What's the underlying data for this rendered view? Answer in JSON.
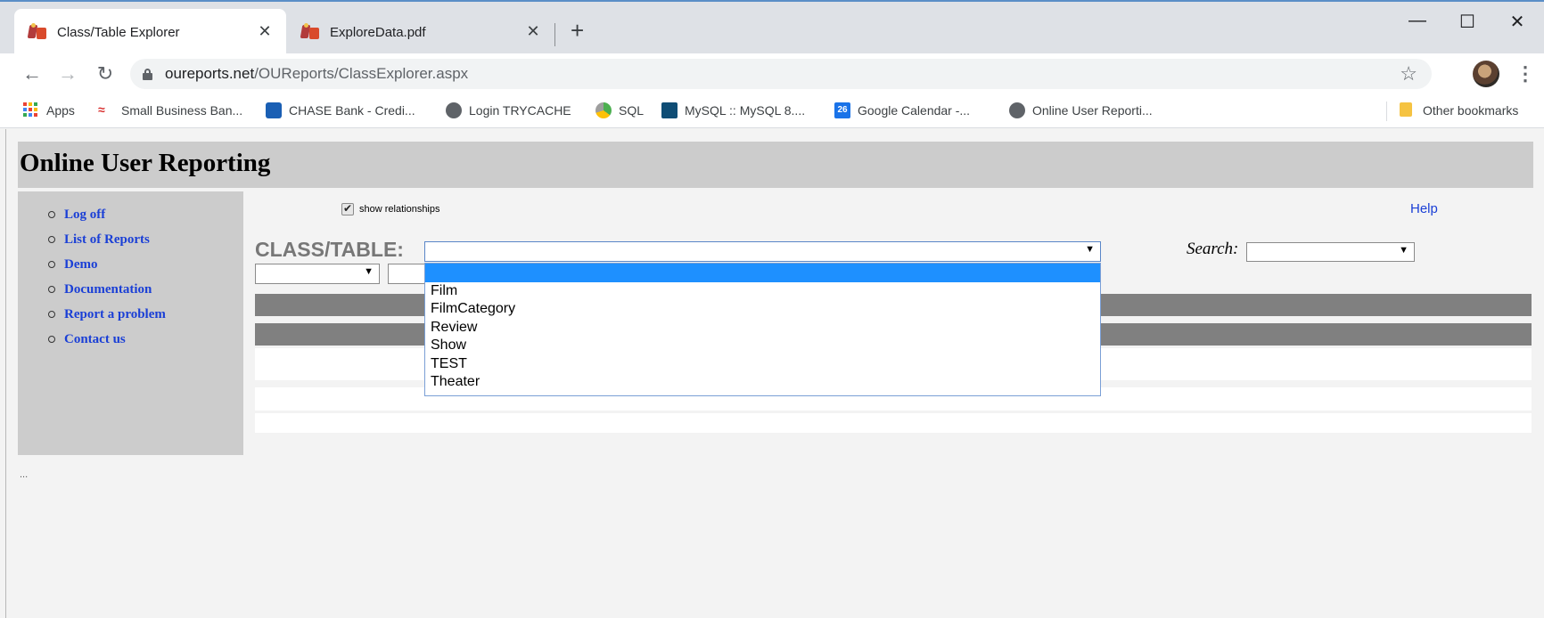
{
  "browser": {
    "tabs": [
      {
        "title": "Class/Table Explorer",
        "active": true
      },
      {
        "title": "ExploreData.pdf",
        "active": false
      }
    ],
    "url_host": "oureports.net",
    "url_path": "/OUReports/ClassExplorer.aspx",
    "bookmarks": [
      {
        "label": "Apps",
        "icon": "apps-grid-icon"
      },
      {
        "label": "Small Business Ban...",
        "icon": "bank-of-america-icon"
      },
      {
        "label": "CHASE Bank - Credi...",
        "icon": "chase-icon"
      },
      {
        "label": "Login TRYCACHE",
        "icon": "globe-icon"
      },
      {
        "label": "SQL",
        "icon": "sql-icon"
      },
      {
        "label": "MySQL :: MySQL 8....",
        "icon": "mysql-icon"
      },
      {
        "label": "Google Calendar -...",
        "icon": "calendar-icon"
      },
      {
        "label": "Online User Reporti...",
        "icon": "globe-icon"
      }
    ],
    "calendar_day": "26",
    "other_bookmarks": "Other bookmarks"
  },
  "page": {
    "site_title": "Online User Reporting",
    "sidebar": [
      {
        "label": "Log off"
      },
      {
        "label": "List of Reports"
      },
      {
        "label": "Demo"
      },
      {
        "label": "Documentation"
      },
      {
        "label": "Report a problem"
      },
      {
        "label": "Contact us"
      }
    ],
    "show_relationships_label": "show relationships",
    "show_relationships_checked": true,
    "help_label": "Help",
    "class_table_label": "CLASS/TABLE:",
    "class_table_value": "",
    "search_label": "Search:",
    "search_value": "",
    "footer_ellipsis": "...",
    "dropdown_options": [
      "",
      "Film",
      "FilmCategory",
      "Review",
      "Show",
      "TEST",
      "Theater"
    ]
  },
  "colors": {
    "accent_blue": "#1e90ff",
    "link_blue": "#1a3fd6",
    "panel_grey": "#cccccc",
    "band_grey": "#808080"
  }
}
